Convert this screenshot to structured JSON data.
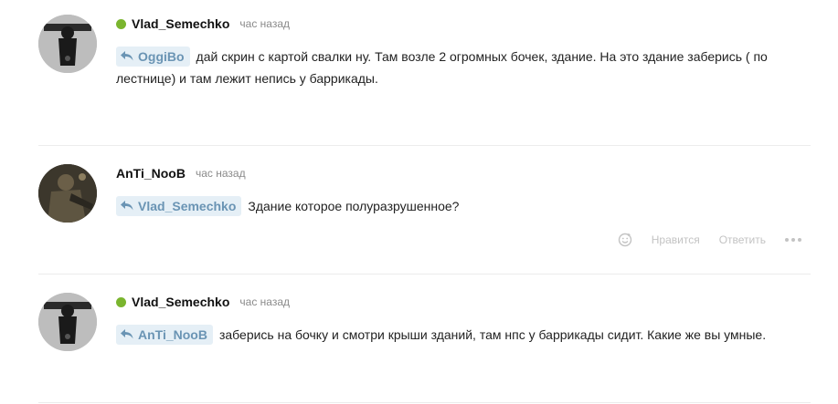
{
  "comments": [
    {
      "username": "Vlad_Semechko",
      "online": true,
      "time": "час назад",
      "reply_to": "OggiBo",
      "text": "дай скрин с картой свалки ну. Там возле 2 огромных бочек, здание. На это здание заберись ( по лестнице) и там лежит непись у баррикады."
    },
    {
      "username": "AnTi_NooB",
      "online": false,
      "time": "час назад",
      "reply_to": "Vlad_Semechko",
      "text": "Здание которое полуразрушенное?",
      "actions": {
        "like_label": "Нравится",
        "reply_label": "Ответить"
      }
    },
    {
      "username": "Vlad_Semechko",
      "online": true,
      "time": "час назад",
      "reply_to": "AnTi_NooB",
      "text": "заберись на бочку и смотри крыши зданий, там нпс у баррикады сидит. Какие же вы умные."
    }
  ],
  "colors": {
    "online": "#7ab52e",
    "reply_tag_bg": "#e5eff6",
    "reply_tag_text": "#6a94b4",
    "muted": "#8a8a8a",
    "action": "#c3c3c3"
  },
  "icons": {
    "reply": "reply-arrow-icon",
    "emoji": "smiley-icon",
    "more": "more-dots-icon"
  }
}
